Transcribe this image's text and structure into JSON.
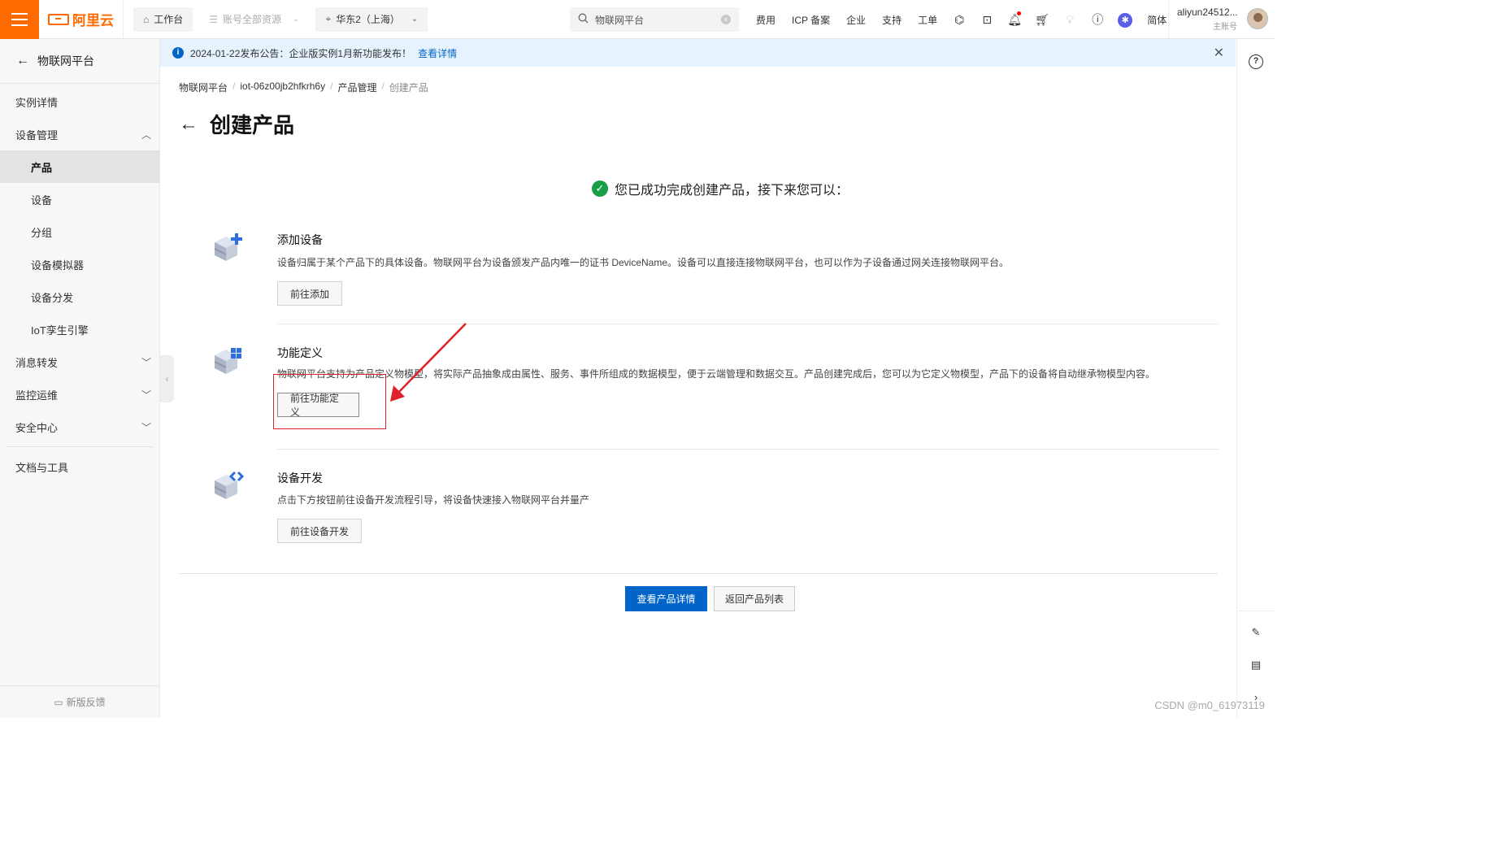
{
  "topbar": {
    "brand": "阿里云",
    "workbench": "工作台",
    "account_scope": "账号全部资源",
    "region": "华东2（上海）",
    "search_placeholder": "物联网平台",
    "links": [
      "费用",
      "ICP 备案",
      "企业",
      "支持",
      "工单"
    ],
    "lang": "简体",
    "account_name": "aliyun24512...",
    "account_type": "主账号"
  },
  "sidebar": {
    "header": "物联网平台",
    "items": [
      {
        "label": "实例详情"
      },
      {
        "label": "设备管理"
      },
      {
        "label": "产品"
      },
      {
        "label": "设备"
      },
      {
        "label": "分组"
      },
      {
        "label": "设备模拟器"
      },
      {
        "label": "设备分发"
      },
      {
        "label": "IoT孪生引擎"
      },
      {
        "label": "消息转发"
      },
      {
        "label": "监控运维"
      },
      {
        "label": "安全中心"
      },
      {
        "label": "文档与工具"
      }
    ],
    "feedback": "新版反馈"
  },
  "notice": {
    "text": "2024-01-22发布公告：企业版实例1月新功能发布！",
    "link": "查看详情"
  },
  "breadcrumb": [
    "物联网平台",
    "iot-06z00jb2hfkrh6y",
    "产品管理",
    "创建产品"
  ],
  "page_title": "创建产品",
  "success_message": "您已成功完成创建产品，接下来您可以：",
  "steps": [
    {
      "title": "添加设备",
      "desc": "设备归属于某个产品下的具体设备。物联网平台为设备颁发产品内唯一的证书 DeviceName。设备可以直接连接物联网平台，也可以作为子设备通过网关连接物联网平台。",
      "button": "前往添加"
    },
    {
      "title": "功能定义",
      "desc": "物联网平台支持为产品定义物模型，将实际产品抽象成由属性、服务、事件所组成的数据模型，便于云端管理和数据交互。产品创建完成后，您可以为它定义物模型，产品下的设备将自动继承物模型内容。",
      "button": "前往功能定义"
    },
    {
      "title": "设备开发",
      "desc": "点击下方按钮前往设备开发流程引导，将设备快速接入物联网平台并量产",
      "button": "前往设备开发"
    }
  ],
  "actions": {
    "primary": "查看产品详情",
    "secondary": "返回产品列表"
  },
  "watermark": "CSDN @m0_61973119",
  "colors": {
    "brand": "#ff6a00",
    "primary": "#0064c8",
    "success": "#1a9e45",
    "annotation": "#e0202a"
  }
}
